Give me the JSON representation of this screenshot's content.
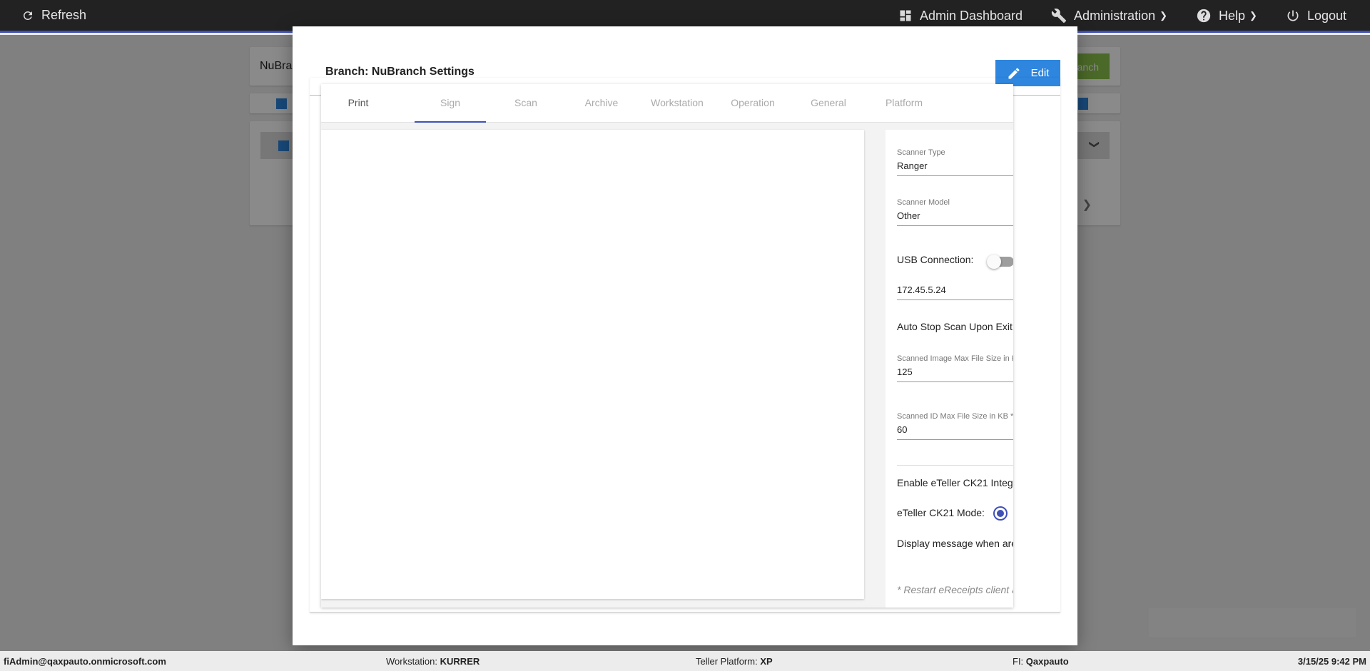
{
  "topbar": {
    "refresh": "Refresh",
    "admin_dashboard": "Admin Dashboard",
    "administration": "Administration",
    "help": "Help",
    "logout": "Logout"
  },
  "background": {
    "search_value": "NuBra",
    "branch_button": "anch"
  },
  "modal": {
    "title": "Branch: NuBranch Settings",
    "edit_label": "Edit",
    "tabs": [
      "Print",
      "Sign",
      "Scan",
      "Archive",
      "Workstation",
      "Operation",
      "General",
      "Platform"
    ],
    "scanner_type_label": "Scanner Type",
    "scanner_type_value": "Ranger",
    "scanner_model_label": "Scanner Model",
    "scanner_model_value": "Other",
    "usb_connection_label": "USB Connection:",
    "ip_address": "172.45.5.24",
    "auto_stop_label": "Auto Stop Scan Upon Exit",
    "image_max_label": "Scanned Image Max File Size in KB",
    "image_max_value": "125",
    "id_max_label": "Scanned ID Max File Size in KB *",
    "id_max_value": "60",
    "ck21_integration_label": "Enable eTeller CK21 Integ",
    "ck21_mode_label": "eTeller CK21 Mode:",
    "display_message_label": "Display message when are",
    "restart_note": "* Restart eReceipts client a"
  },
  "statusbar": {
    "user": "fiAdmin@qaxpauto.onmicrosoft.com",
    "workstation_label": "Workstation:",
    "workstation_value": "KURRER",
    "platform_label": "Teller Platform:",
    "platform_value": "XP",
    "fi_label": "FI:",
    "fi_value": "Qaxpauto",
    "datetime": "3/15/25 9:42 PM"
  },
  "colors": {
    "accent": "#3f51b5",
    "edit_button": "#2e86de",
    "branch_button": "#8bc34a",
    "topbar": "#222222"
  }
}
